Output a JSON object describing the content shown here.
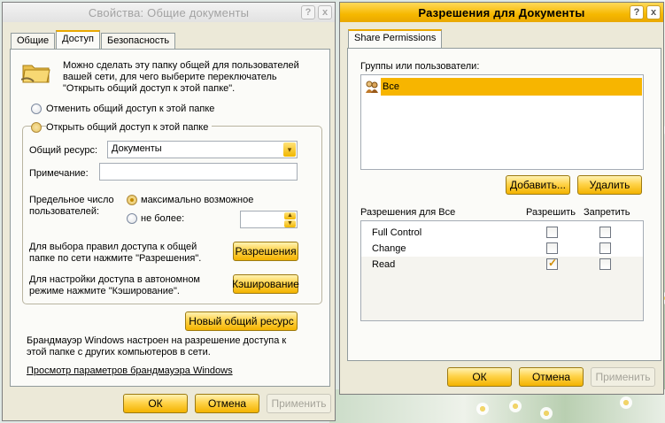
{
  "props_window": {
    "title": "Свойства: Общие документы",
    "tabs": [
      {
        "label": "Общие",
        "active": false
      },
      {
        "label": "Доступ",
        "active": true
      },
      {
        "label": "Безопасность",
        "active": false
      }
    ],
    "info_text": "Можно сделать эту папку общей для пользователей вашей сети, для чего выберите переключатель \"Открыть общий доступ к этой папке\".",
    "radio_unshare": "Отменить общий доступ к этой папке",
    "radio_share": "Открыть общий доступ к этой папке",
    "share_name_label": "Общий ресурс:",
    "share_name_value": "Документы",
    "comment_label": "Примечание:",
    "comment_value": "",
    "user_limit_label": "Предельное число пользователей:",
    "radio_max": "максимально возможное",
    "radio_allow": "не более:",
    "permissions_text": "Для выбора правил доступа к общей папке по сети нажмите \"Разрешения\".",
    "permissions_button": "Разрешения",
    "caching_text": "Для настройки доступа в автономном режиме нажмите \"Кэширование\".",
    "caching_button": "Кэширование",
    "new_share_button": "Новый общий ресурс",
    "firewall_text": "Брандмауэр Windows настроен на разрешение доступа к этой папке с других компьютеров в сети.",
    "firewall_link": "Просмотр параметров брандмауэра Windows",
    "ok": "ОК",
    "cancel": "Отмена",
    "apply": "Применить",
    "help_icon": "?",
    "close_icon": "x"
  },
  "perm_window": {
    "title": "Разрешения для Документы",
    "tab": "Share Permissions",
    "groups_label": "Группы или пользователи:",
    "users": [
      {
        "name": "Все",
        "icon": "users-group-icon",
        "selected": true
      }
    ],
    "add_button": "Добавить...",
    "remove_button": "Удалить",
    "perm_header": "Разрешения для Все",
    "allow_header": "Разрешить",
    "deny_header": "Запретить",
    "permissions": [
      {
        "name": "Full Control",
        "allow": false,
        "deny": false
      },
      {
        "name": "Change",
        "allow": false,
        "deny": false
      },
      {
        "name": "Read",
        "allow": true,
        "deny": false
      }
    ],
    "ok": "ОК",
    "cancel": "Отмена",
    "apply": "Применить",
    "help_icon": "?",
    "close_icon": "x"
  },
  "colors": {
    "accent": "#f3b300",
    "selection": "#f7b500",
    "dialog_bg": "#ece9d8"
  }
}
